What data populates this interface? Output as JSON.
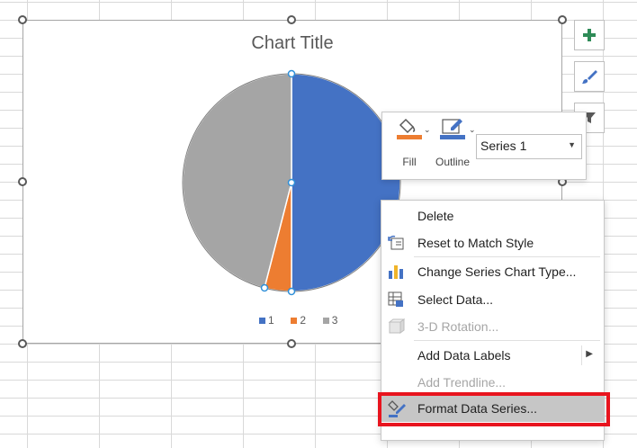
{
  "chart": {
    "title": "Chart Title",
    "legend": [
      "1",
      "2",
      "3"
    ]
  },
  "chart_data": {
    "type": "pie",
    "title": "Chart Title",
    "categories": [
      "1",
      "2",
      "3"
    ],
    "values": [
      50,
      4,
      46
    ],
    "colors": [
      "#4472c4",
      "#ed7d31",
      "#a5a5a5"
    ],
    "legend_position": "bottom"
  },
  "side_buttons": [
    {
      "name": "chart-elements-button",
      "icon": "plus-icon"
    },
    {
      "name": "chart-styles-button",
      "icon": "brush-icon"
    },
    {
      "name": "chart-filters-button",
      "icon": "funnel-icon"
    }
  ],
  "mini_toolbar": {
    "fill_label": "Fill",
    "outline_label": "Outline",
    "series_selected": "Series 1",
    "fill_color": "#ed7d31",
    "outline_color": "#4472c4"
  },
  "context_menu": {
    "items": [
      {
        "label": "Delete",
        "enabled": true
      },
      {
        "label": "Reset to Match Style",
        "enabled": true
      },
      {
        "label": "Change Series Chart Type...",
        "enabled": true
      },
      {
        "label": "Select Data...",
        "enabled": true
      },
      {
        "label": "3-D Rotation...",
        "enabled": false
      },
      {
        "label": "Add Data Labels",
        "enabled": true
      },
      {
        "label": "Add Trendline...",
        "enabled": false
      },
      {
        "label": "Format Data Series...",
        "enabled": true
      }
    ]
  },
  "colors": {
    "highlight": "#e8141e",
    "hover": "#c6c6c6"
  }
}
